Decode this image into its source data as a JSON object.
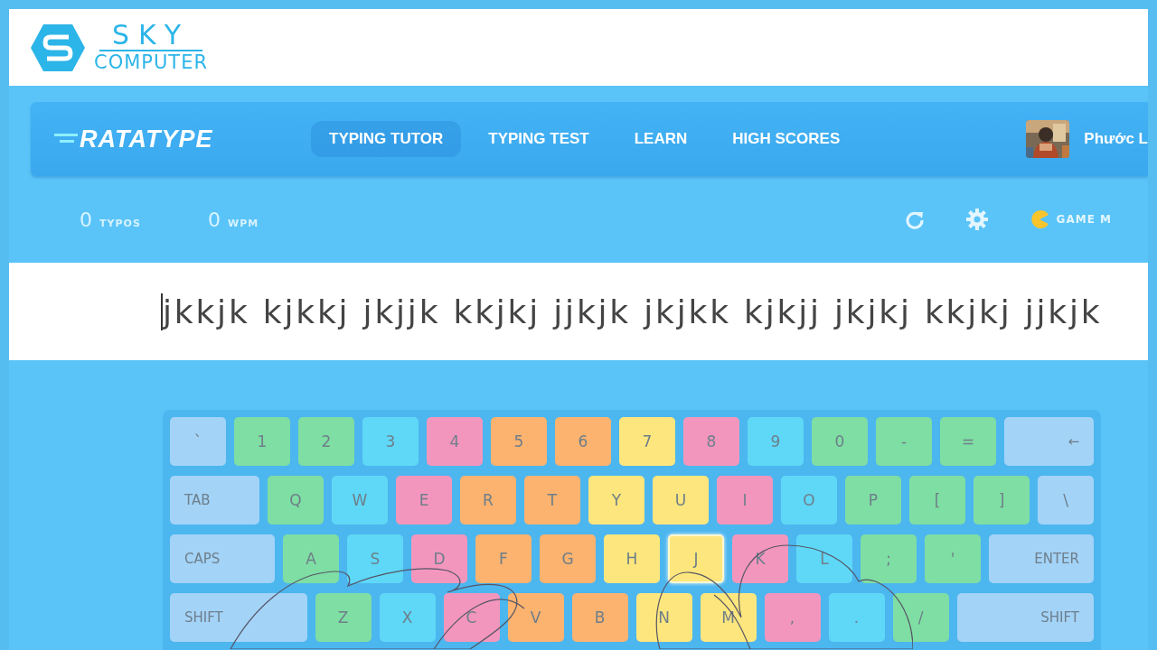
{
  "banner": {
    "title": "SKY",
    "subtitle": "COMPUTER"
  },
  "nav": {
    "logo": "RATATYPE",
    "items": [
      {
        "label": "TYPING TUTOR",
        "selected": true
      },
      {
        "label": "TYPING TEST",
        "selected": false
      },
      {
        "label": "LEARN",
        "selected": false
      },
      {
        "label": "HIGH SCORES",
        "selected": false
      }
    ],
    "user": {
      "name": "Phước L"
    }
  },
  "stats": [
    {
      "value": "0",
      "label": "TYPOS"
    },
    {
      "value": "0",
      "label": "WPM"
    }
  ],
  "game_mode": "GAME M",
  "exercise": "jkkjk kjkkj jkjjk kkjkj jjkjk jkjkk kjkjj jkjkj kkjkj jjkjk",
  "keyboard": {
    "rows": [
      {
        "keys": [
          {
            "label": "`",
            "color": "#a3d3f7",
            "wide": false,
            "active": false
          },
          {
            "label": "1",
            "color": "#7fdea3",
            "wide": false,
            "active": false
          },
          {
            "label": "2",
            "color": "#7fdea3",
            "wide": false,
            "active": false
          },
          {
            "label": "3",
            "color": "#5fd8f7",
            "wide": false,
            "active": false
          },
          {
            "label": "4",
            "color": "#f396bd",
            "wide": false,
            "active": false
          },
          {
            "label": "5",
            "color": "#fbb36f",
            "wide": false,
            "active": false
          },
          {
            "label": "6",
            "color": "#fbb36f",
            "wide": false,
            "active": false
          },
          {
            "label": "7",
            "color": "#fde67d",
            "wide": false,
            "active": false
          },
          {
            "label": "8",
            "color": "#f396bd",
            "wide": false,
            "active": false
          },
          {
            "label": "9",
            "color": "#5fd8f7",
            "wide": false,
            "active": false
          },
          {
            "label": "0",
            "color": "#7fdea3",
            "wide": false,
            "active": false
          },
          {
            "label": "-",
            "color": "#7fdea3",
            "wide": false,
            "active": false
          },
          {
            "label": "=",
            "color": "#7fdea3",
            "wide": false,
            "active": false
          },
          {
            "label": "←",
            "color": "#a3d3f7",
            "wide": true,
            "active": false
          }
        ]
      },
      {
        "keys": [
          {
            "label": "TAB",
            "color": "#a3d3f7",
            "wide": true,
            "active": false
          },
          {
            "label": "Q",
            "color": "#7fdea3",
            "wide": false,
            "active": false
          },
          {
            "label": "W",
            "color": "#5fd8f7",
            "wide": false,
            "active": false
          },
          {
            "label": "E",
            "color": "#f396bd",
            "wide": false,
            "active": false
          },
          {
            "label": "R",
            "color": "#fbb36f",
            "wide": false,
            "active": false
          },
          {
            "label": "T",
            "color": "#fbb36f",
            "wide": false,
            "active": false
          },
          {
            "label": "Y",
            "color": "#fde67d",
            "wide": false,
            "active": false
          },
          {
            "label": "U",
            "color": "#fde67d",
            "wide": false,
            "active": false
          },
          {
            "label": "I",
            "color": "#f396bd",
            "wide": false,
            "active": false
          },
          {
            "label": "O",
            "color": "#5fd8f7",
            "wide": false,
            "active": false
          },
          {
            "label": "P",
            "color": "#7fdea3",
            "wide": false,
            "active": false
          },
          {
            "label": "[",
            "color": "#7fdea3",
            "wide": false,
            "active": false
          },
          {
            "label": "]",
            "color": "#7fdea3",
            "wide": false,
            "active": false
          },
          {
            "label": "\\",
            "color": "#a3d3f7",
            "wide": false,
            "active": false
          }
        ]
      },
      {
        "keys": [
          {
            "label": "CAPS",
            "color": "#a3d3f7",
            "wide": true,
            "active": false
          },
          {
            "label": "A",
            "color": "#7fdea3",
            "wide": false,
            "active": false
          },
          {
            "label": "S",
            "color": "#5fd8f7",
            "wide": false,
            "active": false
          },
          {
            "label": "D",
            "color": "#f396bd",
            "wide": false,
            "active": false
          },
          {
            "label": "F",
            "color": "#fbb36f",
            "wide": false,
            "active": false
          },
          {
            "label": "G",
            "color": "#fbb36f",
            "wide": false,
            "active": false
          },
          {
            "label": "H",
            "color": "#fde67d",
            "wide": false,
            "active": false
          },
          {
            "label": "J",
            "color": "#fde67d",
            "wide": false,
            "active": true
          },
          {
            "label": "K",
            "color": "#f396bd",
            "wide": false,
            "active": false
          },
          {
            "label": "L",
            "color": "#5fd8f7",
            "wide": false,
            "active": false
          },
          {
            "label": ";",
            "color": "#7fdea3",
            "wide": false,
            "active": false
          },
          {
            "label": "'",
            "color": "#7fdea3",
            "wide": false,
            "active": false
          },
          {
            "label": "ENTER",
            "color": "#a3d3f7",
            "wide": true,
            "active": false
          }
        ]
      },
      {
        "keys": [
          {
            "label": "SHIFT",
            "color": "#a3d3f7",
            "wide": true,
            "active": false
          },
          {
            "label": "Z",
            "color": "#7fdea3",
            "wide": false,
            "active": false
          },
          {
            "label": "X",
            "color": "#5fd8f7",
            "wide": false,
            "active": false
          },
          {
            "label": "C",
            "color": "#f396bd",
            "wide": false,
            "active": false
          },
          {
            "label": "V",
            "color": "#fbb36f",
            "wide": false,
            "active": false
          },
          {
            "label": "B",
            "color": "#fbb36f",
            "wide": false,
            "active": false
          },
          {
            "label": "N",
            "color": "#fde67d",
            "wide": false,
            "active": false
          },
          {
            "label": "M",
            "color": "#fde67d",
            "wide": false,
            "active": false
          },
          {
            "label": ",",
            "color": "#f396bd",
            "wide": false,
            "active": false
          },
          {
            "label": ".",
            "color": "#5fd8f7",
            "wide": false,
            "active": false
          },
          {
            "label": "/",
            "color": "#7fdea3",
            "wide": false,
            "active": false
          },
          {
            "label": "SHIFT",
            "color": "#a3d3f7",
            "wide": true,
            "active": false
          }
        ]
      }
    ]
  }
}
